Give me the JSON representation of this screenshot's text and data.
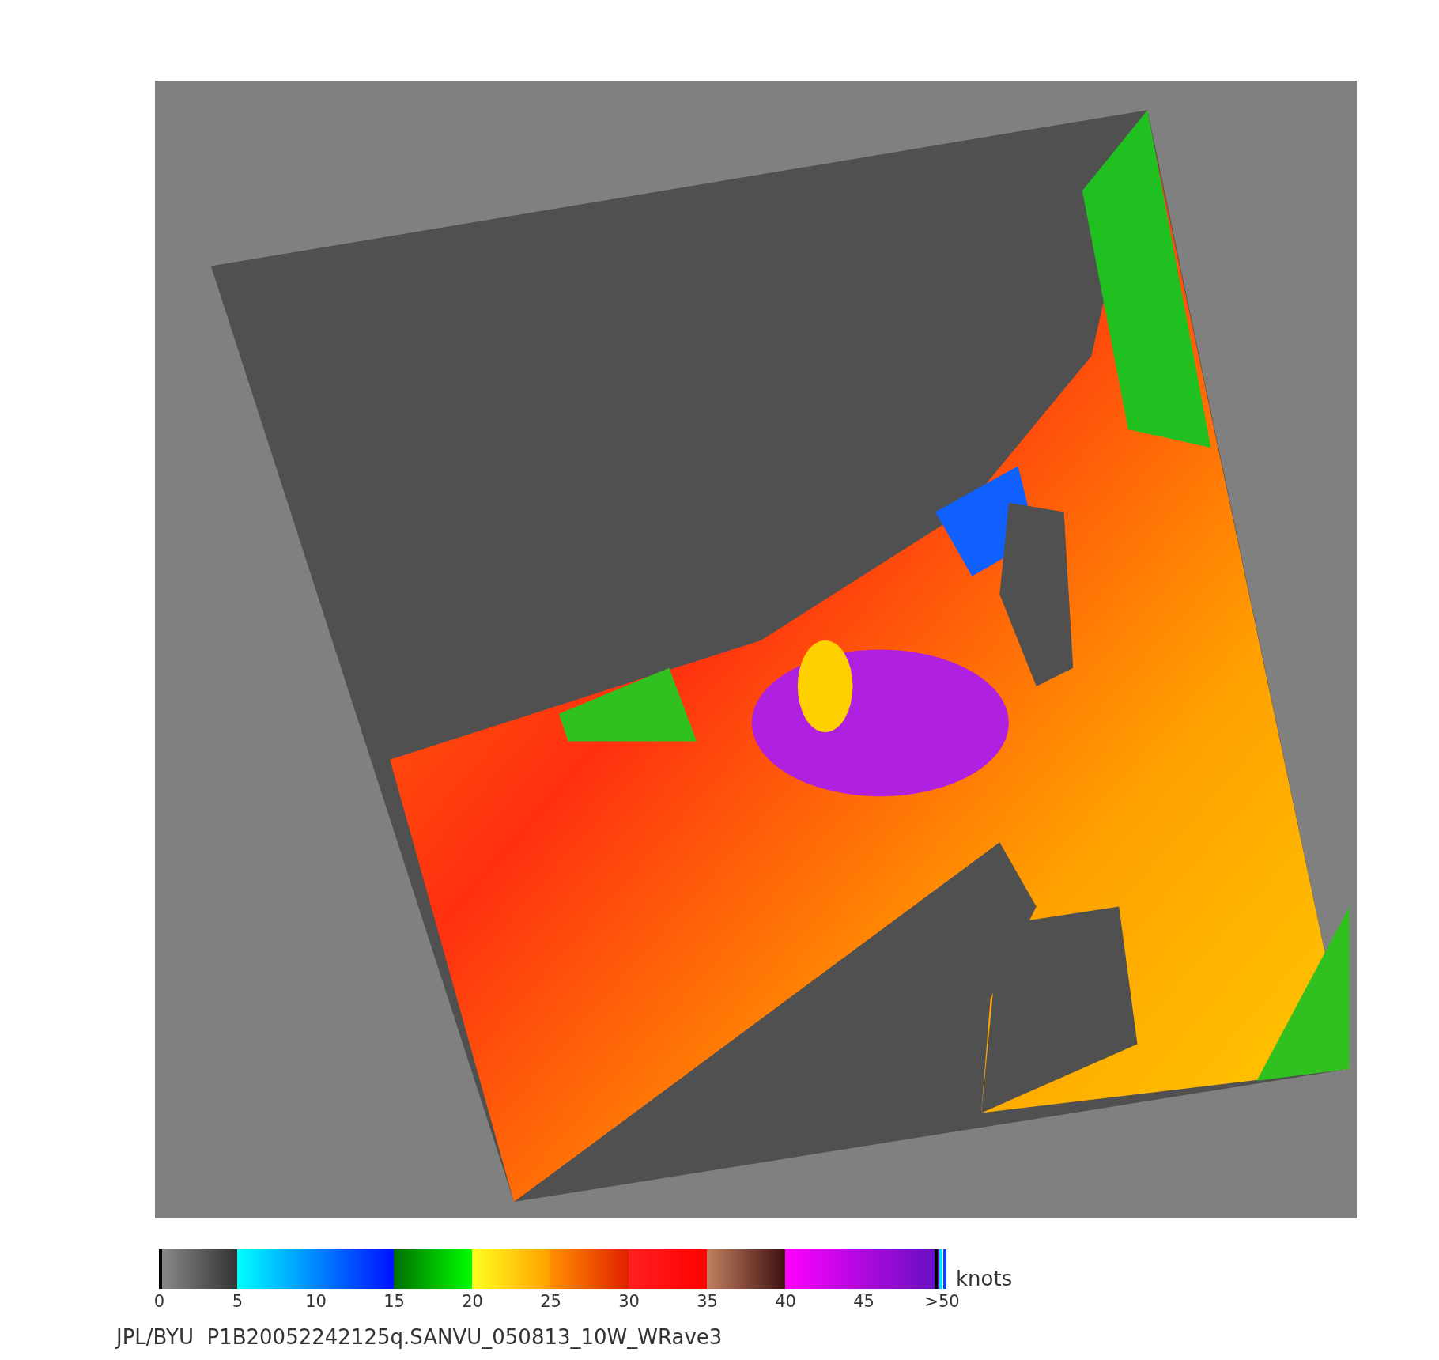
{
  "map": {
    "unit": "knots",
    "scale_labels": [
      "0",
      "5",
      "10",
      "15",
      "20",
      "25",
      "30",
      "35",
      "40",
      "45",
      ">50"
    ]
  },
  "footer": "JPL/BYU  P1B20052242125q.SANVU_050813_10W_WRave3"
}
